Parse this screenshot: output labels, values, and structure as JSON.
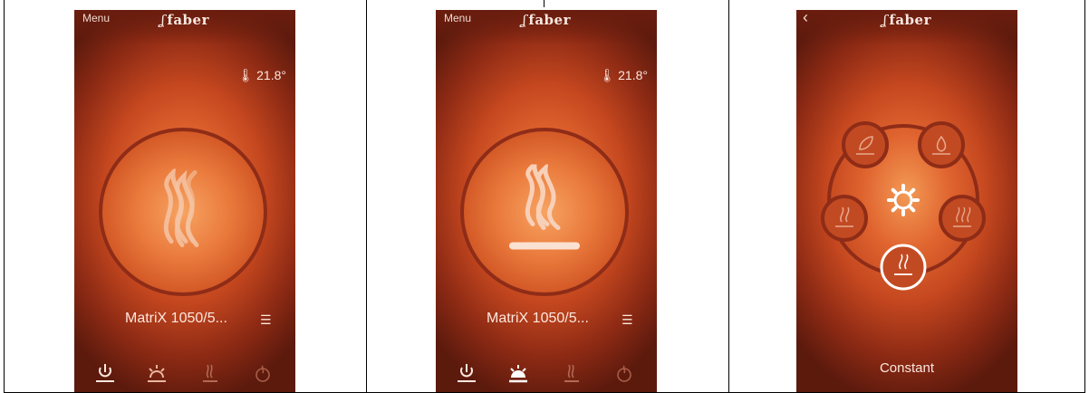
{
  "screens": [
    {
      "menu_label": "Menu",
      "logo_text": "faber",
      "temperature": "21.8°",
      "model_name": "MatriX 1050/5...",
      "active_mode": "power"
    },
    {
      "menu_label": "Menu",
      "logo_text": "faber",
      "temperature": "21.8°",
      "model_name": "MatriX 1050/5...",
      "active_mode": "light"
    },
    {
      "logo_text": "faber",
      "selected_mode_label": "Constant"
    }
  ],
  "colors": {
    "accent_light": "#fde8de",
    "ring": "#8e2c17",
    "background_outer": "#5c1a0d",
    "background_center": "#f39a55"
  },
  "icons": [
    "thermometer-icon",
    "flame-icon",
    "list-icon",
    "power-icon",
    "light-icon",
    "back-icon",
    "gear-icon",
    "leaf-icon",
    "drop-icon"
  ]
}
